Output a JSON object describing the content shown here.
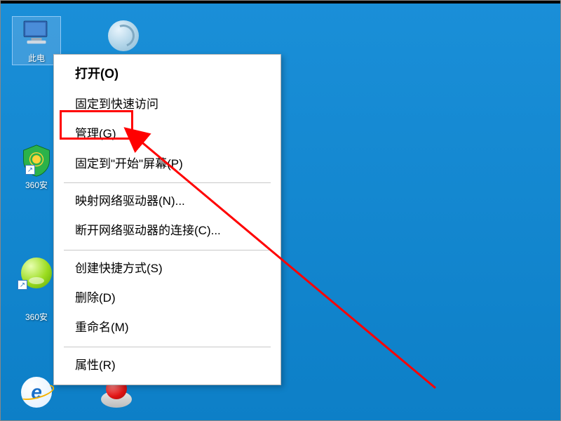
{
  "desktop_icons": {
    "this_pc": {
      "label": "此电"
    },
    "browser": {
      "label": ""
    },
    "security1": {
      "label": "360安"
    },
    "ball": {
      "label": ""
    },
    "security2": {
      "label": "360安"
    },
    "ie": {
      "label": ""
    },
    "red_button": {
      "label": ""
    }
  },
  "context_menu": {
    "open": "打开(O)",
    "pin_quick_access": "固定到快速访问",
    "manage": "管理(G)",
    "pin_start": "固定到\"开始\"屏幕(P)",
    "map_drive": "映射网络驱动器(N)...",
    "disconnect_drive": "断开网络驱动器的连接(C)...",
    "create_shortcut": "创建快捷方式(S)",
    "delete": "删除(D)",
    "rename": "重命名(M)",
    "properties": "属性(R)"
  },
  "annotation": {
    "highlighted_item": "manage",
    "colors": {
      "highlight_border": "#ff0000",
      "arrow": "#ff0000",
      "desktop_bg": "#0d7fc7"
    }
  }
}
